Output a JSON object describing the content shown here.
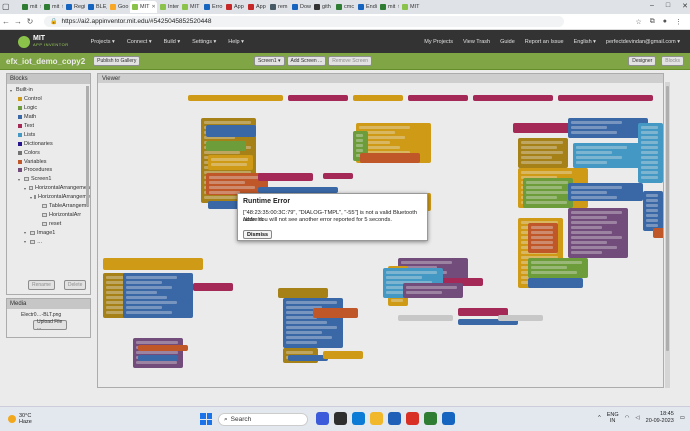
{
  "browser": {
    "tabs": [
      {
        "label": "mit",
        "color": "#2e7d32"
      },
      {
        "label": "mit",
        "color": "#2e7d32"
      },
      {
        "label": "Regi",
        "color": "#1565c0"
      },
      {
        "label": "BLE_",
        "color": "#1565c0"
      },
      {
        "label": "Goo",
        "color": "#f9a825"
      },
      {
        "label": "MIT",
        "color": "#8bc34a",
        "active": true
      },
      {
        "label": "Inter",
        "color": "#8bc34a"
      },
      {
        "label": "MIT",
        "color": "#8bc34a"
      },
      {
        "label": "Erro",
        "color": "#1565c0"
      },
      {
        "label": "App",
        "color": "#c62828"
      },
      {
        "label": "App",
        "color": "#c62828"
      },
      {
        "label": "rem",
        "color": "#455a64"
      },
      {
        "label": "Dow",
        "color": "#1565c0"
      },
      {
        "label": "gith",
        "color": "#333333"
      },
      {
        "label": "cmc",
        "color": "#2e7d32"
      },
      {
        "label": "Endi",
        "color": "#1565c0"
      },
      {
        "label": "mit",
        "color": "#2e7d32"
      },
      {
        "label": "MIT",
        "color": "#8bc34a"
      }
    ],
    "url": "https://ai2.appinventor.mit.edu/#5425045852520448"
  },
  "ai_header": {
    "logo_name": "MIT",
    "logo_sub": "APP INVENTOR",
    "menu": [
      "Projects ▾",
      "Connect ▾",
      "Build ▾",
      "Settings ▾",
      "Help ▾"
    ],
    "right_links": [
      "My Projects",
      "View Trash",
      "Guide",
      "Report an Issue",
      "English ▾",
      "perfectdevindan@gmail.com ▾"
    ]
  },
  "project_bar": {
    "project_name": "efx_iot_demo_copy2",
    "publish_label": "Publish to Gallery",
    "screen_select": "Screen1 ▾",
    "add_screen": "Add Screen ...",
    "remove_screen": "Remove Screen",
    "designer": "Designer",
    "blocks": "Blocks"
  },
  "blocks_panel": {
    "title": "Blocks",
    "builtin_label": "Built-in",
    "builtin": [
      {
        "label": "Control",
        "color": "#e1a91a"
      },
      {
        "label": "Logic",
        "color": "#77ab41"
      },
      {
        "label": "Math",
        "color": "#3f71b5"
      },
      {
        "label": "Text",
        "color": "#b32d5e"
      },
      {
        "label": "Lists",
        "color": "#49a6d4"
      },
      {
        "label": "Dictionaries",
        "color": "#2d1799"
      },
      {
        "label": "Colors",
        "color": "#7d7d7d"
      },
      {
        "label": "Variables",
        "color": "#d05f2d"
      },
      {
        "label": "Procedures",
        "color": "#7c5385"
      }
    ],
    "components": [
      {
        "label": "Screen1",
        "level": 1
      },
      {
        "label": "HorizontalArrangemen",
        "level": 2
      },
      {
        "label": "HorizontalArrangeme",
        "level": 3
      },
      {
        "label": "TableArrangeme",
        "level": 4
      },
      {
        "label": "HorizontalArr",
        "level": 4
      },
      {
        "label": "reset",
        "level": 4
      },
      {
        "label": "Image1",
        "level": 2
      },
      {
        "label": "…",
        "level": 2
      }
    ],
    "rename": "Rename",
    "delete": "Delete"
  },
  "media_panel": {
    "title": "Media",
    "file": "Electr0…-BLT.png",
    "upload": "Upload File ..."
  },
  "viewer": {
    "title": "Viewer"
  },
  "dialog": {
    "title": "Runtime Error",
    "message": "[\"48:23:35:00:3C:79\", \"DIALOG-TMPL\", \"-55\"] is not a valid Bluetooth address",
    "note_label": "Note:",
    "note_text": " You will not see another error reported for 5 seconds.",
    "dismiss": "Dismiss"
  },
  "taskbar": {
    "temp": "30°C",
    "weather": "Haze",
    "search_placeholder": "Search",
    "lang1": "ENG",
    "lang2": "IN",
    "time": "18:45",
    "date": "20-09-2023"
  },
  "colors": {
    "ai_green": "#8bb34a",
    "header_dark": "#333333"
  }
}
